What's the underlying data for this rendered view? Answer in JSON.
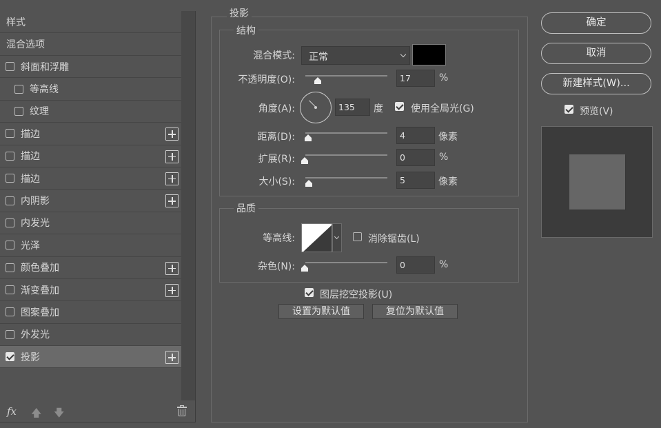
{
  "left_panel": {
    "styles_header": "样式",
    "blending_options": "混合选项",
    "items": [
      {
        "label": "斜面和浮雕",
        "checked": false,
        "indent": false,
        "plus": false
      },
      {
        "label": "等高线",
        "checked": false,
        "indent": true,
        "plus": false
      },
      {
        "label": "纹理",
        "checked": false,
        "indent": true,
        "plus": false
      },
      {
        "label": "描边",
        "checked": false,
        "indent": false,
        "plus": true
      },
      {
        "label": "描边",
        "checked": false,
        "indent": false,
        "plus": true
      },
      {
        "label": "描边",
        "checked": false,
        "indent": false,
        "plus": true
      },
      {
        "label": "内阴影",
        "checked": false,
        "indent": false,
        "plus": true
      },
      {
        "label": "内发光",
        "checked": false,
        "indent": false,
        "plus": false
      },
      {
        "label": "光泽",
        "checked": false,
        "indent": false,
        "plus": false
      },
      {
        "label": "颜色叠加",
        "checked": false,
        "indent": false,
        "plus": true
      },
      {
        "label": "渐变叠加",
        "checked": false,
        "indent": false,
        "plus": true
      },
      {
        "label": "图案叠加",
        "checked": false,
        "indent": false,
        "plus": false
      },
      {
        "label": "外发光",
        "checked": false,
        "indent": false,
        "plus": false
      },
      {
        "label": "投影",
        "checked": true,
        "indent": false,
        "plus": true,
        "active": true
      }
    ],
    "footer": {
      "fx_label": "fx",
      "up_icon": "arrow-up-icon",
      "down_icon": "arrow-down-icon",
      "trash_icon": "trash-icon"
    }
  },
  "drop_shadow": {
    "section_title": "投影",
    "structure": {
      "title": "结构",
      "blend_mode_label": "混合模式:",
      "blend_mode_value": "正常",
      "shadow_color": "#000000",
      "opacity_label": "不透明度(O):",
      "opacity_value": "17",
      "opacity_unit": "%",
      "opacity_fraction": 0.17,
      "angle_label": "角度(A):",
      "angle_value": "135",
      "angle_unit": "度",
      "global_light_label": "使用全局光(G)",
      "global_light_checked": true,
      "distance_label": "距离(D):",
      "distance_value": "4",
      "distance_unit": "像素",
      "spread_label": "扩展(R):",
      "spread_value": "0",
      "spread_unit": "%",
      "size_label": "大小(S):",
      "size_value": "5",
      "size_unit": "像素"
    },
    "quality": {
      "title": "品质",
      "contour_label": "等高线:",
      "anti_alias_label": "消除锯齿(L)",
      "anti_alias_checked": false,
      "noise_label": "杂色(N):",
      "noise_value": "0",
      "noise_unit": "%"
    },
    "knockout_label": "图层挖空投影(U)",
    "knockout_checked": true,
    "make_default_label": "设置为默认值",
    "reset_default_label": "复位为默认值"
  },
  "right_panel": {
    "ok_label": "确定",
    "cancel_label": "取消",
    "new_style_label": "新建样式(W)...",
    "preview_label": "预览(V)",
    "preview_checked": true
  }
}
